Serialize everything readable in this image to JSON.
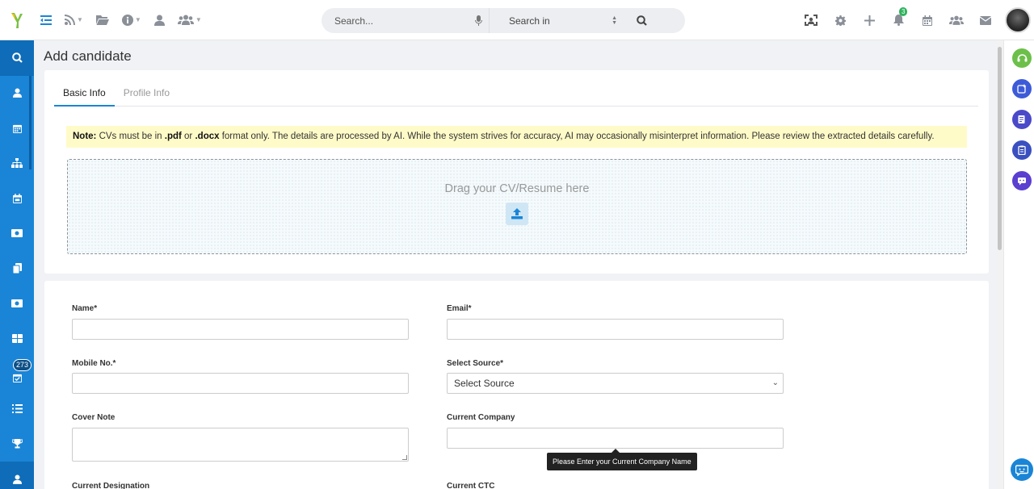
{
  "topbar": {
    "search_placeholder": "Search...",
    "search_in_label": "Search in",
    "notification_count": "3"
  },
  "sidebar": {
    "badge_count": "273"
  },
  "page": {
    "title": "Add candidate"
  },
  "tabs": [
    {
      "label": "Basic Info"
    },
    {
      "label": "Profile Info"
    }
  ],
  "note": {
    "prefix": "Note:",
    "text1": " CVs must be in ",
    "pdf": ".pdf",
    "or": " or ",
    "docx": ".docx",
    "text2": " format only. The details are processed by AI. While the system strives for accuracy, AI may occasionally misinterpret information. Please review the extracted details carefully."
  },
  "dropzone": {
    "text": "Drag your CV/Resume here"
  },
  "form": {
    "name_label": "Name*",
    "email_label": "Email*",
    "mobile_label": "Mobile No.*",
    "source_label": "Select Source*",
    "source_value": "Select Source",
    "cover_note_label": "Cover Note",
    "current_company_label": "Current Company",
    "current_designation_label": "Current Designation",
    "current_ctc_label": "Current CTC"
  },
  "tooltip": {
    "text": "Please Enter your Current Company Name"
  },
  "colors": {
    "sidebar": "#1a85d6",
    "note_bg": "#fffbc8",
    "accent": "#1a85d6"
  }
}
